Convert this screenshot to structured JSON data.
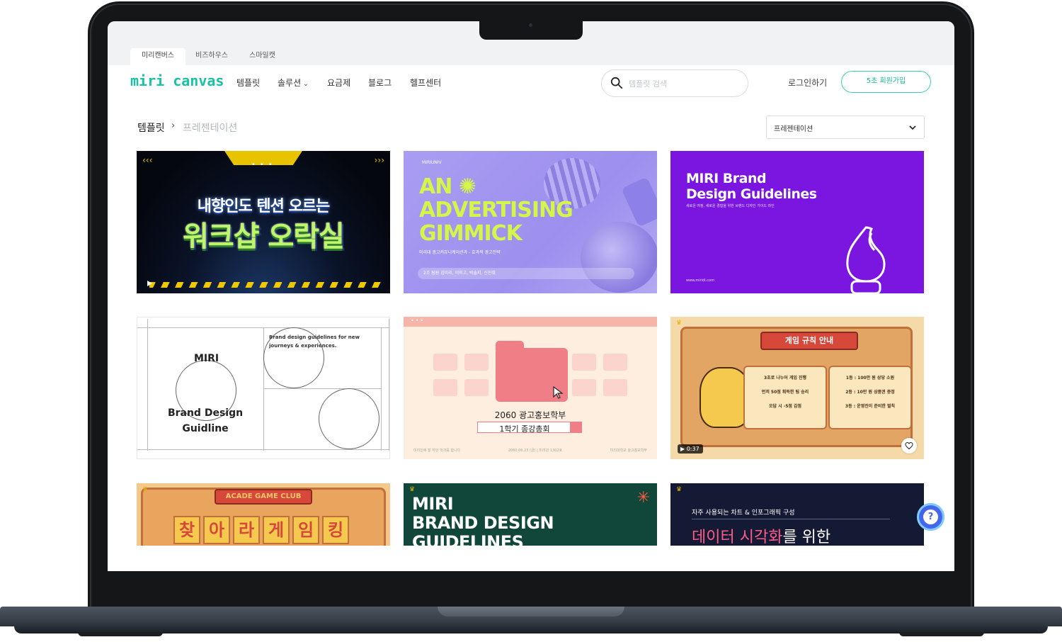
{
  "site_tabs": [
    "미리캔버스",
    "비즈하우스",
    "스마일캣"
  ],
  "logo": "miri canvas",
  "nav": {
    "items": [
      "템플릿",
      "솔루션",
      "요금제",
      "블로그",
      "헬프센터"
    ],
    "search_placeholder": "템플릿 검색",
    "login": "로그인하기",
    "signup": "5초 회원가입"
  },
  "breadcrumb": {
    "root": "템플릿",
    "separator": "›",
    "current": "프레젠테이션"
  },
  "category_select": "프레젠테이션",
  "cards": {
    "c1": {
      "line1": "내향인도 텐션 오르는",
      "line2": "워크샵 오락실"
    },
    "c2": {
      "small": "MIRIUNIV",
      "title1": "AN",
      "title2": "ADVERTISING",
      "title3": "GIMMICK",
      "sub": "미리대 광고커뮤니케이션과 - 효과적 광고전략",
      "pill": "2조 팀원  김미리, 이미고, 박솔지, 신진희"
    },
    "c3": {
      "title1": "MIRI Brand",
      "title2": "Design Guidelines",
      "sub": "새로운 여정, 새로운 경험을 위한 브랜드 디자인 가이드 라인",
      "url": "www.miridi.com"
    },
    "c4": {
      "miri": "MIRI",
      "brand1": "Brand Design",
      "brand2": "Guidline",
      "guide": "Brand design guidelines for new journeys & experiences."
    },
    "c5": {
      "line1": "2060 광고홍보학부",
      "line2": "1학기 종강총회",
      "foot_left": "미리안에 잘 하던 학과를 합니다",
      "foot_mid": "2060.06.23 (금) | 미리관 1302호",
      "foot_right": "미리대학교 광고홍보학부"
    },
    "c6": {
      "banner": "게임 규칙 안내",
      "left1": "3초로 나누어 게임 진행",
      "left2": "먼저 50점 획득한 팀 승리",
      "left3": "오답 시 -5점 감점",
      "right1": "1등 : 100만 원 상당 소원",
      "right2": "2등 : 10만 원 상품권 증정",
      "right3": "3등 : 운영진이 준비한 벌칙",
      "time": "0:37"
    },
    "c7": {
      "banner": "ACADE GAME CLUB",
      "chars": [
        "찾",
        "아",
        "라",
        "게",
        "임",
        "킹"
      ]
    },
    "c8": {
      "title1": "MIRI",
      "title2": "BRAND DESIGN",
      "title3": "GUIDELINES"
    },
    "c9": {
      "sub": "자주 사용되는 차트 & 인포그래픽 구성",
      "title_pink": "데이터 시각화",
      "title_rest": "를 위한"
    }
  },
  "help_label": "?",
  "colors": {
    "brand": "#17c3a2",
    "accent_purple": "#7a16e0",
    "help": "#4466ee"
  }
}
